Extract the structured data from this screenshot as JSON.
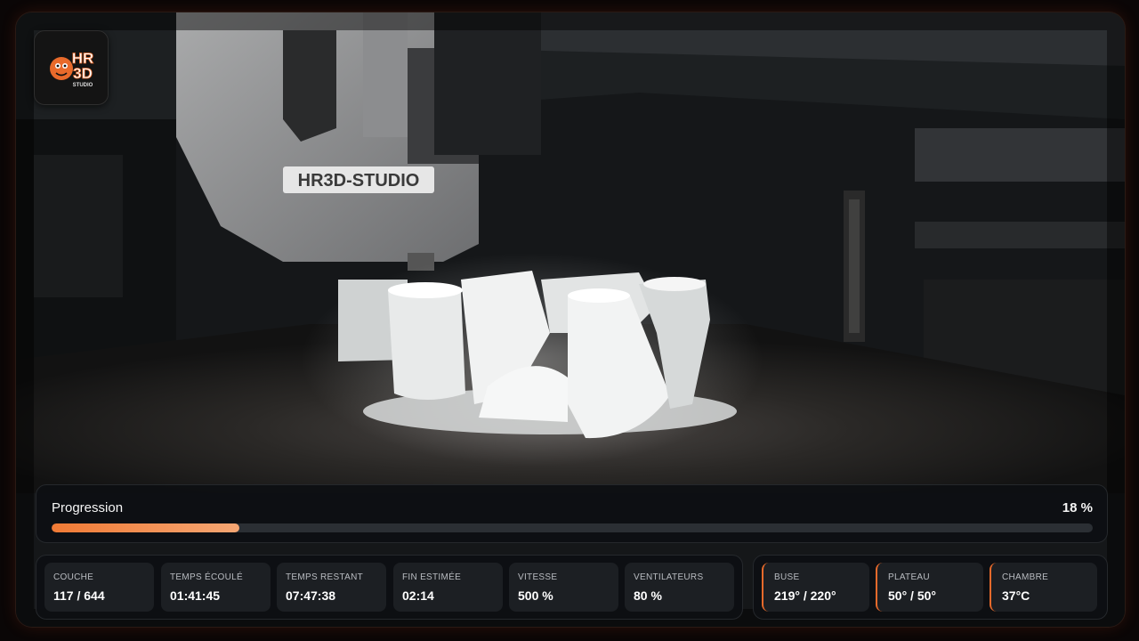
{
  "camera": {
    "watermark_text": "HR3D-STUDIO"
  },
  "logo": {
    "text_top": "HR",
    "text_bottom": "3D",
    "text_sub": "STUDIO"
  },
  "progress": {
    "label": "Progression",
    "value_text": "18 %",
    "fraction": 0.18
  },
  "stats": [
    {
      "label": "COUCHE",
      "value": "117 / 644"
    },
    {
      "label": "TEMPS ÉCOULÉ",
      "value": "01:41:45"
    },
    {
      "label": "TEMPS RESTANT",
      "value": "07:47:38"
    },
    {
      "label": "FIN ESTIMÉE",
      "value": "02:14"
    },
    {
      "label": "VITESSE",
      "value": "500 %"
    },
    {
      "label": "VENTILATEURS",
      "value": "80 %"
    }
  ],
  "temps": [
    {
      "label": "BUSE",
      "value": "219° / 220°"
    },
    {
      "label": "PLATEAU",
      "value": "50° / 50°"
    },
    {
      "label": "CHAMBRE",
      "value": "37°C"
    }
  ],
  "colors": {
    "accent": "#e86a2b",
    "progress_start": "#f07a35",
    "progress_end": "#f5a673",
    "panel_bg": "#0e1013",
    "card_bg": "#1c1f23"
  }
}
